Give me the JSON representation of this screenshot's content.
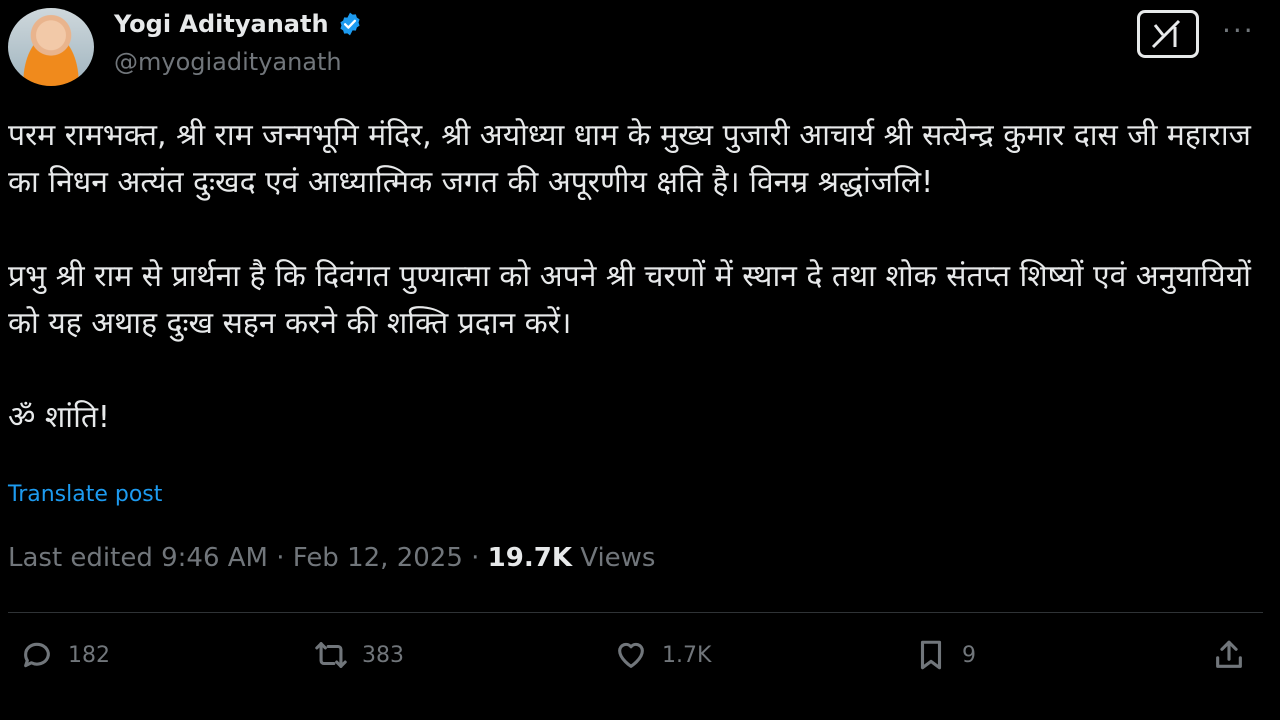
{
  "post": {
    "author_name": "Yogi Adityanath",
    "handle": "@myogiadityanath",
    "paragraphs": [
      "परम रामभक्त, श्री राम जन्मभूमि मंदिर, श्री अयोध्या धाम के मुख्य पुजारी आचार्य श्री सत्येन्द्र कुमार दास जी महाराज का निधन अत्यंत दुःखद एवं आध्यात्मिक जगत की अपूरणीय क्षति है। विनम्र श्रद्धांजलि!",
      "प्रभु श्री राम से प्रार्थना है कि दिवंगत पुण्यात्मा को अपने श्री चरणों में स्थान दे तथा शोक संतप्त शिष्यों एवं अनुयायियों को यह अथाह दुःख सहन करने की शक्ति प्रदान करें।",
      "ॐ शांति!"
    ],
    "translate_label": "Translate post",
    "meta": {
      "edited": "Last edited 9:46 AM",
      "separator": " · ",
      "date": "Feb 12, 2025",
      "views_count": "19.7K",
      "views_label": " Views"
    },
    "actions": {
      "replies": "182",
      "reposts": "383",
      "likes": "1.7K",
      "bookmarks": "9"
    }
  },
  "colors": {
    "background": "#000000",
    "text": "#e7e9ea",
    "muted": "#71767b",
    "link": "#1d9bf0"
  }
}
